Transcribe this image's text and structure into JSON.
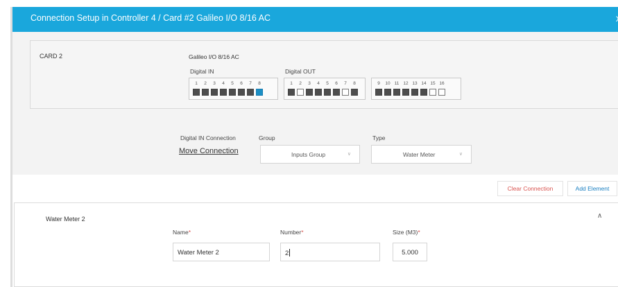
{
  "modal": {
    "title": "Connection Setup in Controller 4 / Card #2 Galileo I/O 8/16 AC",
    "close_glyph": "x"
  },
  "card": {
    "label": "CARD 2",
    "model": "Galileo I/O 8/16 AC",
    "digital_in": {
      "label": "Digital IN",
      "ports": [
        {
          "num": "1",
          "state": "off"
        },
        {
          "num": "2",
          "state": "off"
        },
        {
          "num": "3",
          "state": "off"
        },
        {
          "num": "4",
          "state": "off"
        },
        {
          "num": "5",
          "state": "off"
        },
        {
          "num": "6",
          "state": "off"
        },
        {
          "num": "7",
          "state": "off"
        },
        {
          "num": "8",
          "state": "active"
        }
      ]
    },
    "digital_out": {
      "label": "Digital OUT",
      "ports": [
        {
          "num": "1",
          "state": "off"
        },
        {
          "num": "2",
          "state": "empty"
        },
        {
          "num": "3",
          "state": "off"
        },
        {
          "num": "4",
          "state": "off"
        },
        {
          "num": "5",
          "state": "off"
        },
        {
          "num": "6",
          "state": "off"
        },
        {
          "num": "7",
          "state": "empty"
        },
        {
          "num": "8",
          "state": "off"
        },
        {
          "num": "9",
          "state": "off"
        },
        {
          "num": "10",
          "state": "off"
        },
        {
          "num": "11",
          "state": "off"
        },
        {
          "num": "12",
          "state": "off"
        },
        {
          "num": "13",
          "state": "off"
        },
        {
          "num": "14",
          "state": "off"
        },
        {
          "num": "15",
          "state": "empty"
        },
        {
          "num": "16",
          "state": "empty"
        }
      ]
    }
  },
  "connection": {
    "label": "Digital IN Connection",
    "move_link": "Move Connection",
    "group_label": "Group",
    "group_value": "Inputs Group",
    "type_label": "Type",
    "type_value": "Water Meter"
  },
  "actions": {
    "clear": "Clear Connection",
    "add": "Add Element"
  },
  "element": {
    "title": "Water Meter 2",
    "name_label": "Name",
    "name_value": "Water Meter 2",
    "number_label": "Number",
    "number_value": "2",
    "size_label": "Size (M3)",
    "size_value": "5.000",
    "required_mark": "*"
  },
  "colors": {
    "header": "#1aa7dc",
    "active_port": "#1b8fc4",
    "danger": "#d9534f",
    "link": "#1a7fc1"
  },
  "icons": {
    "close": "close-icon",
    "collapse": "chevron-up-icon",
    "select_caret": "chevron-down-icon"
  }
}
